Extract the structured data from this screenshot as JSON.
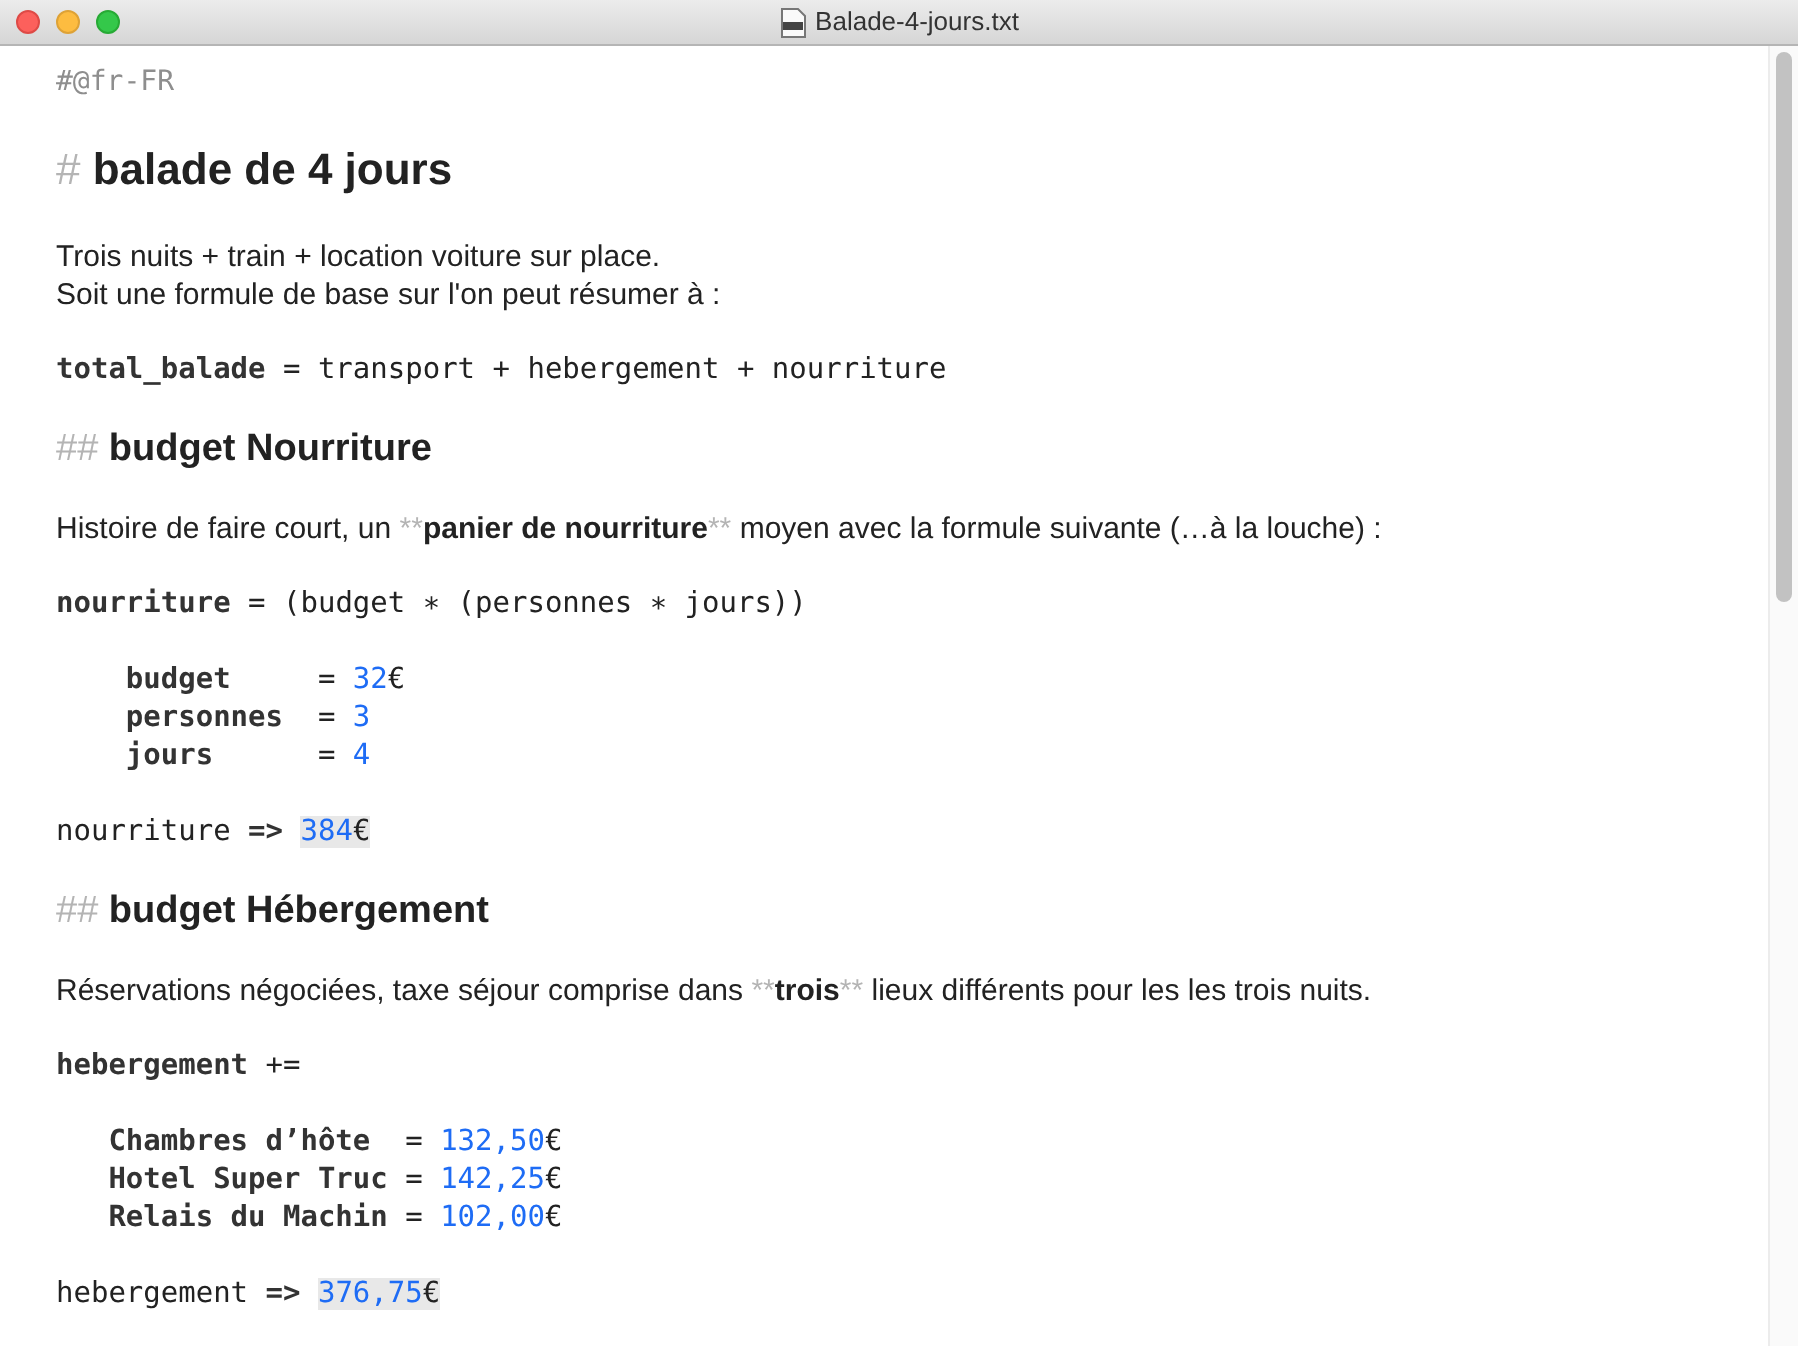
{
  "window": {
    "title": "Balade-4-jours.txt"
  },
  "blocks": [
    {
      "lines": [
        {
          "kind": "comment",
          "tokens": [
            {
              "kind": "comment",
              "text": "#@fr-FR"
            }
          ]
        }
      ]
    },
    {
      "lines": [
        {
          "kind": "h1",
          "tokens": [
            {
              "kind": "marker",
              "text": "# "
            },
            {
              "kind": "heading",
              "text": "balade de 4 jours"
            }
          ]
        }
      ]
    },
    {
      "lines": [
        {
          "kind": "text",
          "tokens": [
            {
              "kind": "plain",
              "text": "Trois nuits + train + location voiture sur place."
            }
          ]
        },
        {
          "kind": "text",
          "tokens": [
            {
              "kind": "plain",
              "text": "Soit une formule de base sur l'on peut résumer à :"
            }
          ]
        }
      ]
    },
    {
      "lines": [
        {
          "kind": "code",
          "tokens": [
            {
              "kind": "keyword",
              "text": "total_balade"
            },
            {
              "kind": "code",
              "text": " = transport + hebergement + nourriture"
            }
          ]
        }
      ]
    },
    {
      "lines": [
        {
          "kind": "h2",
          "tokens": [
            {
              "kind": "marker",
              "text": "## "
            },
            {
              "kind": "heading",
              "text": "budget Nourriture"
            }
          ]
        }
      ]
    },
    {
      "lines": [
        {
          "kind": "text",
          "tokens": [
            {
              "kind": "plain",
              "text": "Histoire de faire court, un "
            },
            {
              "kind": "marker",
              "text": "**"
            },
            {
              "kind": "bold",
              "text": "panier de nourriture"
            },
            {
              "kind": "marker",
              "text": "**"
            },
            {
              "kind": "plain",
              "text": " moyen avec la formule suivante (…à la louche) :"
            }
          ]
        }
      ]
    },
    {
      "lines": [
        {
          "kind": "code",
          "tokens": [
            {
              "kind": "keyword",
              "text": "nourriture"
            },
            {
              "kind": "code",
              "text": " = (budget ∗ (personnes ∗ jours))"
            }
          ]
        }
      ]
    },
    {
      "lines": [
        {
          "kind": "code",
          "tokens": [
            {
              "kind": "keyword",
              "text": "    budget     "
            },
            {
              "kind": "code",
              "text": "= "
            },
            {
              "kind": "number",
              "text": "32"
            },
            {
              "kind": "code",
              "text": "€"
            }
          ]
        },
        {
          "kind": "code",
          "tokens": [
            {
              "kind": "keyword",
              "text": "    personnes  "
            },
            {
              "kind": "code",
              "text": "= "
            },
            {
              "kind": "number",
              "text": "3"
            }
          ]
        },
        {
          "kind": "code",
          "tokens": [
            {
              "kind": "keyword",
              "text": "    jours      "
            },
            {
              "kind": "code",
              "text": "= "
            },
            {
              "kind": "number",
              "text": "4"
            }
          ]
        }
      ]
    },
    {
      "lines": [
        {
          "kind": "code",
          "tokens": [
            {
              "kind": "code",
              "text": "nourriture "
            },
            {
              "kind": "keyword",
              "text": "=> "
            },
            {
              "kind": "result",
              "text": "384"
            },
            {
              "kind": "result-unit",
              "text": "€"
            }
          ]
        }
      ]
    },
    {
      "lines": [
        {
          "kind": "h2",
          "tokens": [
            {
              "kind": "marker",
              "text": "## "
            },
            {
              "kind": "heading",
              "text": "budget Hébergement"
            }
          ]
        }
      ]
    },
    {
      "lines": [
        {
          "kind": "text",
          "tokens": [
            {
              "kind": "plain",
              "text": "Réservations négociées, taxe séjour comprise dans "
            },
            {
              "kind": "marker",
              "text": "**"
            },
            {
              "kind": "bold",
              "text": "trois"
            },
            {
              "kind": "marker",
              "text": "**"
            },
            {
              "kind": "plain",
              "text": " lieux différents pour les les trois nuits."
            }
          ]
        }
      ]
    },
    {
      "lines": [
        {
          "kind": "code",
          "tokens": [
            {
              "kind": "keyword",
              "text": "hebergement"
            },
            {
              "kind": "code",
              "text": " +="
            }
          ]
        }
      ]
    },
    {
      "lines": [
        {
          "kind": "code",
          "tokens": [
            {
              "kind": "keyword",
              "text": "   Chambres d’hôte  "
            },
            {
              "kind": "code",
              "text": "= "
            },
            {
              "kind": "number",
              "text": "132,50"
            },
            {
              "kind": "code",
              "text": "€"
            }
          ]
        },
        {
          "kind": "code",
          "tokens": [
            {
              "kind": "keyword",
              "text": "   Hotel Super Truc "
            },
            {
              "kind": "code",
              "text": "= "
            },
            {
              "kind": "number",
              "text": "142,25"
            },
            {
              "kind": "code",
              "text": "€"
            }
          ]
        },
        {
          "kind": "code",
          "tokens": [
            {
              "kind": "keyword",
              "text": "   Relais du Machin "
            },
            {
              "kind": "code",
              "text": "= "
            },
            {
              "kind": "number",
              "text": "102,00"
            },
            {
              "kind": "code",
              "text": "€"
            }
          ]
        }
      ]
    },
    {
      "lines": [
        {
          "kind": "code",
          "tokens": [
            {
              "kind": "code",
              "text": "hebergement "
            },
            {
              "kind": "keyword",
              "text": "=> "
            },
            {
              "kind": "result",
              "text": "376,75"
            },
            {
              "kind": "result-unit",
              "text": "€"
            }
          ]
        }
      ]
    }
  ]
}
